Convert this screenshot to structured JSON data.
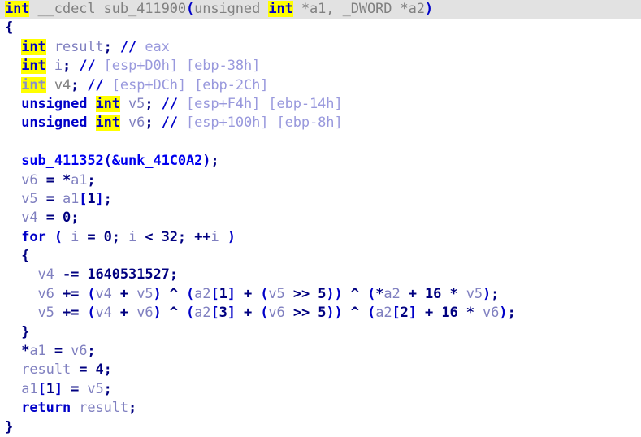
{
  "view": {
    "kind": "decompiler-pseudocode",
    "background": "#ffffff",
    "current_line_highlight": "#e2e2e2",
    "highlight_color": "#ffff00",
    "function_name": "sub_411900",
    "line_count": 22
  },
  "colors": {
    "keyword": "#0000c8",
    "keyword_dim": "#8a90c8",
    "calling_convention": "#808080",
    "function_call": "#0000ee",
    "variable": "#8080c0",
    "punctuation": "#0000c8",
    "number": "#000080",
    "comment": "#9999dd",
    "comment_marker": "#0000c8",
    "highlight_bg": "#ffff00",
    "current_line_bg": "#e2e2e2"
  },
  "code": {
    "signature": {
      "return_type": "int",
      "calling_convention": "__cdecl",
      "name": "sub_411900",
      "params": "(unsigned int *a1, _DWORD *a2)",
      "param_1_type": "unsigned int",
      "param_1_name": "*a1",
      "param_2_type": "_DWORD",
      "param_2_name": "*a2"
    },
    "declarations": [
      {
        "type": "int",
        "name": "result",
        "comment": "eax"
      },
      {
        "type": "int",
        "name": "i",
        "comment": "[esp+D0h] [ebp-38h]"
      },
      {
        "type": "int",
        "name": "v4",
        "comment": "[esp+DCh] [ebp-2Ch]"
      },
      {
        "type": "unsigned int",
        "name": "v5",
        "comment": "[esp+F4h] [ebp-14h]"
      },
      {
        "type": "unsigned int",
        "name": "v6",
        "comment": "[esp+100h] [ebp-8h]"
      }
    ],
    "lines": [
      {
        "n": 1,
        "text": "int __cdecl sub_411900(unsigned int *a1, _DWORD *a2)",
        "current": true
      },
      {
        "n": 2,
        "text": "{"
      },
      {
        "n": 3,
        "text": "  int result; // eax"
      },
      {
        "n": 4,
        "text": "  int i; // [esp+D0h] [ebp-38h]"
      },
      {
        "n": 5,
        "text": "  int v4; // [esp+DCh] [ebp-2Ch]"
      },
      {
        "n": 6,
        "text": "  unsigned int v5; // [esp+F4h] [ebp-14h]"
      },
      {
        "n": 7,
        "text": "  unsigned int v6; // [esp+100h] [ebp-8h]"
      },
      {
        "n": 8,
        "text": ""
      },
      {
        "n": 9,
        "text": "  sub_411352(&unk_41C0A2);"
      },
      {
        "n": 10,
        "text": "  v6 = *a1;"
      },
      {
        "n": 11,
        "text": "  v5 = a1[1];"
      },
      {
        "n": 12,
        "text": "  v4 = 0;"
      },
      {
        "n": 13,
        "text": "  for ( i = 0; i < 32; ++i )"
      },
      {
        "n": 14,
        "text": "  {"
      },
      {
        "n": 15,
        "text": "    v4 -= 1640531527;"
      },
      {
        "n": 16,
        "text": "    v6 += (v4 + v5) ^ (a2[1] + (v5 >> 5)) ^ (*a2 + 16 * v5);"
      },
      {
        "n": 17,
        "text": "    v5 += (v4 + v6) ^ (a2[3] + (v6 >> 5)) ^ (a2[2] + 16 * v6);"
      },
      {
        "n": 18,
        "text": "  }"
      },
      {
        "n": 19,
        "text": "  *a1 = v6;"
      },
      {
        "n": 20,
        "text": "  result = 4;"
      },
      {
        "n": 21,
        "text": "  a1[1] = v5;"
      },
      {
        "n": 22,
        "text": "  return result;"
      },
      {
        "n": 23,
        "text": "}"
      }
    ],
    "called_function": "sub_411352",
    "called_argument": "&unk_41C0A2",
    "loop_bound": "32",
    "delta_constant": "1640531527",
    "shift_amount": "5",
    "multiplier": "16",
    "return_value": "4",
    "highlighted_token": "int"
  }
}
